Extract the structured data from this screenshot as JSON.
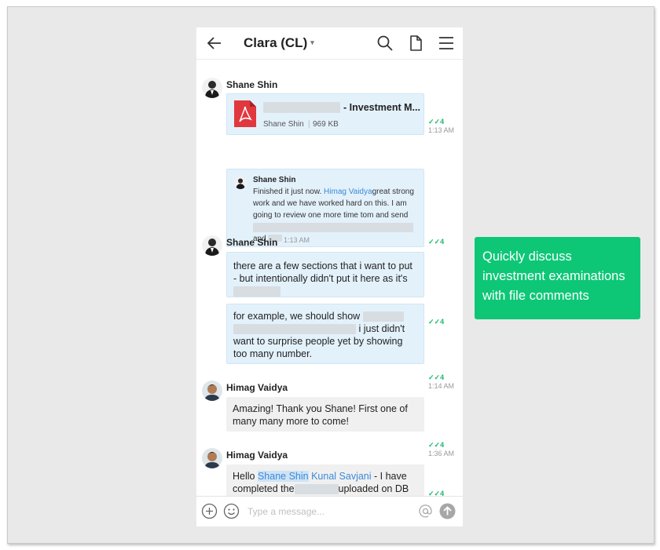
{
  "header": {
    "title": "Clara (CL)",
    "caret": "▾"
  },
  "messages": {
    "group1": {
      "sender": "Shane Shin",
      "file": {
        "name_suffix": "- Investment M...",
        "uploader": "Shane Shin",
        "size": "969 KB",
        "read_count": "4",
        "time": "1:13 AM"
      },
      "comment": {
        "author": "Shane Shin",
        "text_pre": "Finished it just now. ",
        "mention": "Himag Vaidya",
        "text_post": "great strong work and we have worked hard on this.  I am going to review one more time tom and send",
        "text_and": "and",
        "time": "1:13 AM",
        "read_count": "4"
      }
    },
    "group2": {
      "sender": "Shane Shin",
      "bubble1": {
        "line1": "there are a few sections that i want to put",
        "line2": "- but intentionally didn't put it here as it's",
        "read_count": "4"
      },
      "bubble2": {
        "line1": "for example, we should show",
        "line2": "i just didn't",
        "line3": "want to surprise people yet by showing",
        "line4": "too many number.",
        "read_count": "4",
        "time": "1:14 AM"
      }
    },
    "group3": {
      "sender": "Himag Vaidya",
      "line1": "Amazing! Thank you Shane! First one of",
      "line2": "many many more to come!",
      "read_count": "4",
      "time": "1:36 AM"
    },
    "group4": {
      "sender": "Himag Vaidya",
      "hello": "Hello ",
      "mention1": "Shane Shin",
      "mention2": "Kunal Savjani",
      "tail": " - I have",
      "line2_pre": "completed the",
      "line2_post": "uploaded on DB",
      "read_count": "4"
    }
  },
  "input": {
    "placeholder": "Type a message..."
  },
  "callout": {
    "line1": "Quickly discuss",
    "line2": "investment examinations",
    "line3": "with file comments"
  },
  "colors": {
    "accent_green": "#0dc777",
    "read_green": "#1fb86b",
    "mention_blue": "#3a8ad8",
    "bubble_blue": "#e3f1fb",
    "pdf_red": "#e0383e"
  },
  "icons": [
    "back-arrow-icon",
    "search-icon",
    "file-icon",
    "menu-icon",
    "pdf-icon",
    "read-check-icon",
    "add-icon",
    "emoji-icon",
    "at-icon",
    "send-icon"
  ]
}
